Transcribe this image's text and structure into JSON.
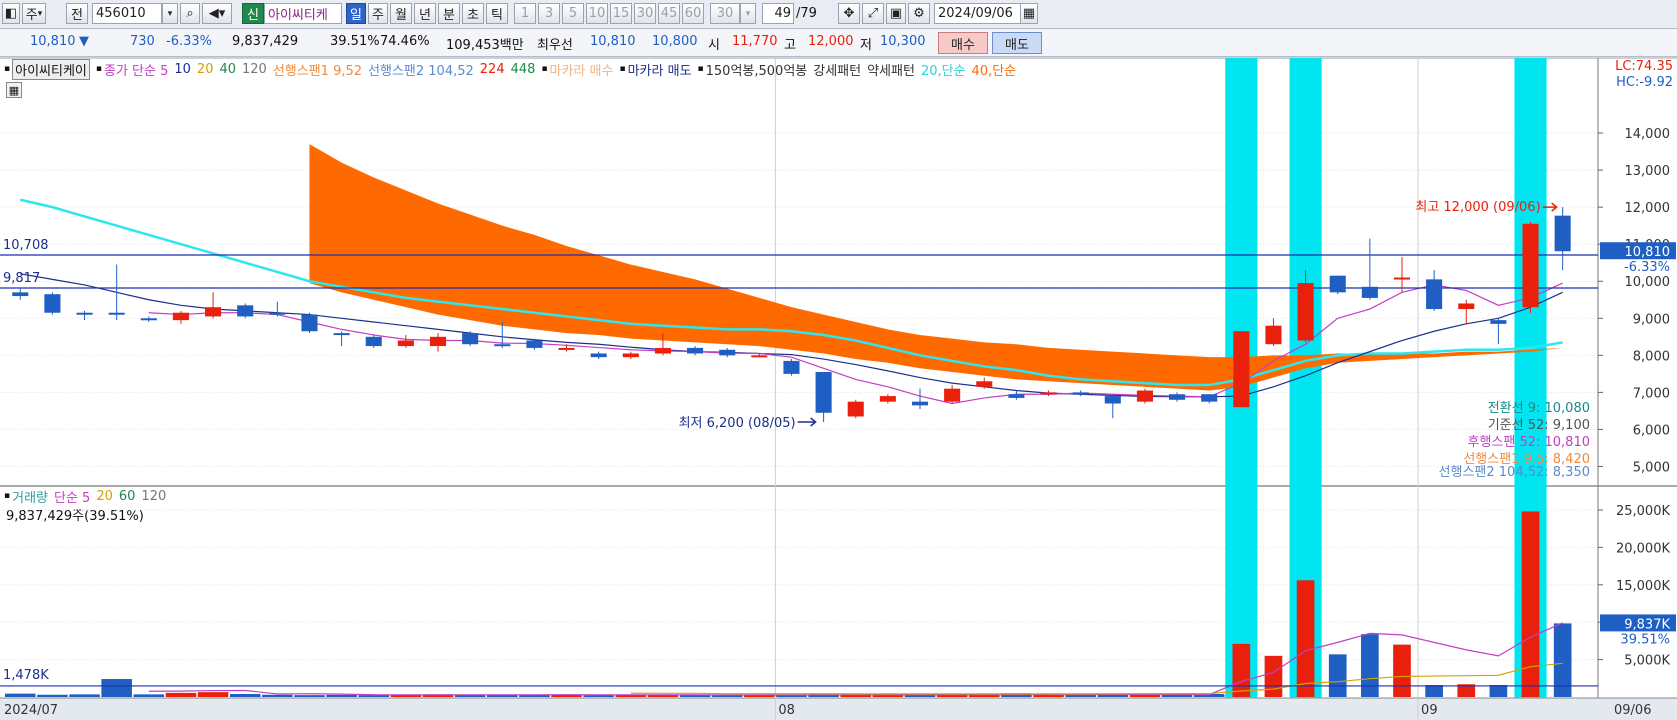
{
  "toolbar": {
    "market": "주",
    "prev": "전",
    "code": "456010",
    "badge": "신",
    "name": "아이씨티케",
    "periods": [
      "일",
      "주",
      "월",
      "년",
      "분",
      "초",
      "틱"
    ],
    "active_period": "일",
    "intervals": [
      "1",
      "3",
      "5",
      "10",
      "15",
      "30",
      "45",
      "60"
    ],
    "interval_value": "30",
    "page_counter": "49",
    "page_total": "/79",
    "date": "2024/09/06"
  },
  "info": {
    "price": "10,810",
    "change_arrow": "▼",
    "change": "730",
    "change_pct": "-6.33%",
    "volume": "9,837,429",
    "vol_pct": "39.51%",
    "pct2": "74.46%",
    "amount": "109,453백만",
    "best_label": "최우선",
    "best_sell": "10,810",
    "best_buy": "10,800",
    "open_label": "시",
    "open": "11,770",
    "high_label": "고",
    "high": "12,000",
    "low_label": "저",
    "low": "10,300",
    "buy_button": "매수",
    "sell_button": "매도"
  },
  "price_legend": {
    "name": "아이씨티케이",
    "close_ma": "종가 단순 5",
    "ma10": "10",
    "ma20": "20",
    "ma40": "40",
    "ma120": "120",
    "span1": "선행스팬1 9,52",
    "span2": "선행스팬2 104,52",
    "p224": "224",
    "p448": "448",
    "macara_buy": "마카라 매수",
    "macara_sell": "마카라 매도",
    "bong": "150억봉,500억봉",
    "strong": "강세패턴",
    "weak": "약세패턴",
    "ma20s": "20,단순",
    "ma40s": "40,단순"
  },
  "lc": "LC:74.35",
  "hc": "HC:-9.92",
  "price_axis": [
    "14,000",
    "13,000",
    "12,000",
    "11,000",
    "10,000",
    "9,000",
    "8,000",
    "7,000",
    "6,000",
    "5,000"
  ],
  "current_price_tag": "10,810",
  "current_pct_tag": "-6.33%",
  "line_10708": "10,708",
  "line_9817": "9,817",
  "high_annot": "최고 12,000 (09/06)",
  "low_annot": "최저 6,200 (08/05)",
  "ichimoku": {
    "conv": "전환선 9: 10,080",
    "base": "기준선 52: 9,100",
    "lag": "후행스팬 52: 10,810",
    "lead1": "선행스팬1 9,5: 8,420",
    "lead2": "선행스팬2 104,52: 8,350"
  },
  "vol_legend": {
    "name": "거래량",
    "ma": "단순 5",
    "v20": "20",
    "v60": "60",
    "v120": "120",
    "value": "9,837,429주(39.51%)"
  },
  "vol_axis": [
    "25,000K",
    "20,000K",
    "15,000K",
    "10,000K",
    "5,000K"
  ],
  "vol_current_tag": "9,837K",
  "vol_pct_tag": "39.51%",
  "vol_line_label": "1,478K",
  "date_axis": [
    "2024/07",
    "08",
    "09"
  ],
  "last_date": "09/06",
  "colors": {
    "up": "#e8200c",
    "down": "#1f5fc4",
    "cloud": "#ff6a00",
    "highlight": "#00e5f0",
    "ma_blue": "#1c2f8a",
    "ma_pink": "#c43ec4"
  },
  "chart_data": {
    "type": "candlestick",
    "candles": [
      {
        "o": 9700,
        "c": 9600,
        "h": 9800,
        "l": 9500
      },
      {
        "o": 9650,
        "c": 9150,
        "h": 9700,
        "l": 9100
      },
      {
        "o": 9150,
        "c": 9100,
        "h": 9200,
        "l": 8950
      },
      {
        "o": 9150,
        "c": 9100,
        "h": 10450,
        "l": 8950
      },
      {
        "o": 9000,
        "c": 8950,
        "h": 9050,
        "l": 8900
      },
      {
        "o": 8950,
        "c": 9150,
        "h": 9200,
        "l": 8850
      },
      {
        "o": 9050,
        "c": 9300,
        "h": 9700,
        "l": 9000
      },
      {
        "o": 9350,
        "c": 9050,
        "h": 9400,
        "l": 9000
      },
      {
        "o": 9150,
        "c": 9100,
        "h": 9450,
        "l": 9050
      },
      {
        "o": 9100,
        "c": 8650,
        "h": 9150,
        "l": 8600
      },
      {
        "o": 8600,
        "c": 8550,
        "h": 8650,
        "l": 8250
      },
      {
        "o": 8500,
        "c": 8250,
        "h": 8550,
        "l": 8200
      },
      {
        "o": 8250,
        "c": 8400,
        "h": 8550,
        "l": 8200
      },
      {
        "o": 8250,
        "c": 8500,
        "h": 8600,
        "l": 8100
      },
      {
        "o": 8600,
        "c": 8300,
        "h": 8650,
        "l": 8250
      },
      {
        "o": 8300,
        "c": 8250,
        "h": 8900,
        "l": 8200
      },
      {
        "o": 8400,
        "c": 8200,
        "h": 8450,
        "l": 8150
      },
      {
        "o": 8150,
        "c": 8200,
        "h": 8300,
        "l": 8100
      },
      {
        "o": 8050,
        "c": 7950,
        "h": 8100,
        "l": 7900
      },
      {
        "o": 7950,
        "c": 8050,
        "h": 8100,
        "l": 7900
      },
      {
        "o": 8050,
        "c": 8200,
        "h": 8600,
        "l": 8000
      },
      {
        "o": 8200,
        "c": 8050,
        "h": 8250,
        "l": 8000
      },
      {
        "o": 8150,
        "c": 8000,
        "h": 8200,
        "l": 7950
      },
      {
        "o": 8000,
        "c": 8000,
        "h": 8050,
        "l": 7950
      },
      {
        "o": 7850,
        "c": 7500,
        "h": 7900,
        "l": 7450
      },
      {
        "o": 7550,
        "c": 6450,
        "h": 7550,
        "l": 6200
      },
      {
        "o": 6350,
        "c": 6750,
        "h": 6800,
        "l": 6300
      },
      {
        "o": 6750,
        "c": 6900,
        "h": 6950,
        "l": 6700
      },
      {
        "o": 6750,
        "c": 6650,
        "h": 7100,
        "l": 6550
      },
      {
        "o": 6750,
        "c": 7100,
        "h": 7200,
        "l": 6700
      },
      {
        "o": 7150,
        "c": 7300,
        "h": 7400,
        "l": 7100
      },
      {
        "o": 6950,
        "c": 6850,
        "h": 7050,
        "l": 6800
      },
      {
        "o": 6950,
        "c": 7000,
        "h": 7050,
        "l": 6900
      },
      {
        "o": 7000,
        "c": 6950,
        "h": 7050,
        "l": 6900
      },
      {
        "o": 6900,
        "c": 6700,
        "h": 6950,
        "l": 6300
      },
      {
        "o": 6750,
        "c": 7050,
        "h": 7100,
        "l": 6700
      },
      {
        "o": 6950,
        "c": 6800,
        "h": 7000,
        "l": 6750
      },
      {
        "o": 6950,
        "c": 6750,
        "h": 6950,
        "l": 6700
      },
      {
        "o": 6600,
        "c": 8650,
        "h": 8650,
        "l": 6600
      },
      {
        "o": 8300,
        "c": 8800,
        "h": 9000,
        "l": 8250
      },
      {
        "o": 8400,
        "c": 9950,
        "h": 10300,
        "l": 8350
      },
      {
        "o": 10150,
        "c": 9700,
        "h": 10150,
        "l": 9650
      },
      {
        "o": 9850,
        "c": 9550,
        "h": 11150,
        "l": 9500
      },
      {
        "o": 10050,
        "c": 10100,
        "h": 10650,
        "l": 9700
      },
      {
        "o": 10050,
        "c": 9250,
        "h": 10300,
        "l": 9200
      },
      {
        "o": 9250,
        "c": 9400,
        "h": 9500,
        "l": 8850
      },
      {
        "o": 8950,
        "c": 8850,
        "h": 9000,
        "l": 8300
      },
      {
        "o": 9300,
        "c": 11550,
        "h": 11600,
        "l": 9150
      },
      {
        "o": 11770,
        "c": 10810,
        "h": 12000,
        "l": 10300
      }
    ],
    "volumes_k": [
      450,
      300,
      350,
      2400,
      350,
      550,
      650,
      400,
      300,
      250,
      280,
      250,
      280,
      350,
      280,
      330,
      300,
      300,
      230,
      300,
      300,
      250,
      260,
      300,
      250,
      380,
      300,
      220,
      250,
      350,
      280,
      500,
      300,
      280,
      300,
      300,
      300,
      400,
      7100,
      5500,
      15600,
      5700,
      8400,
      7000,
      1600,
      1700,
      1600,
      24800,
      9837
    ],
    "ma5_price": [
      null,
      null,
      null,
      null,
      9150,
      9100,
      9150,
      9150,
      9100,
      8900,
      8700,
      8550,
      8430,
      8400,
      8400,
      8330,
      8320,
      8270,
      8210,
      8150,
      8120,
      8100,
      8060,
      8050,
      7950,
      7650,
      7350,
      7150,
      6900,
      6700,
      6850,
      6950,
      6950,
      6980,
      6950,
      6920,
      6900,
      6880,
      7250,
      7850,
      8300,
      9000,
      9250,
      9700,
      9900,
      9750,
      9350,
      9550,
      9950
    ],
    "ma10_price": [
      10200,
      10050,
      9900,
      9700,
      9500,
      9350,
      9250,
      9200,
      9150,
      9100,
      9000,
      8900,
      8800,
      8700,
      8600,
      8500,
      8420,
      8350,
      8300,
      8220,
      8150,
      8100,
      8080,
      8050,
      8020,
      7900,
      7750,
      7580,
      7400,
      7250,
      7150,
      7050,
      6980,
      6950,
      6920,
      6890,
      6880,
      6880,
      6900,
      7150,
      7450,
      7800,
      8100,
      8400,
      8650,
      8850,
      9000,
      9300,
      9700
    ],
    "cloud_top": [
      null,
      null,
      null,
      null,
      null,
      null,
      null,
      null,
      null,
      13700,
      13200,
      12800,
      12450,
      12100,
      11800,
      11500,
      11250,
      10950,
      10700,
      10450,
      10250,
      10050,
      9800,
      9550,
      9300,
      9100,
      8900,
      8700,
      8550,
      8450,
      8350,
      8300,
      8200,
      8150,
      8100,
      8050,
      8000,
      7950,
      7950,
      8000,
      8000,
      8050,
      8050,
      8050,
      8050,
      8100,
      8100,
      8150,
      8200
    ],
    "cloud_bottom": [
      null,
      null,
      null,
      null,
      null,
      null,
      null,
      null,
      null,
      9950,
      9700,
      9500,
      9300,
      9100,
      8950,
      8800,
      8700,
      8600,
      8550,
      8450,
      8400,
      8350,
      8300,
      8250,
      8150,
      8050,
      7900,
      7800,
      7650,
      7550,
      7450,
      7350,
      7300,
      7250,
      7200,
      7150,
      7100,
      7050,
      7150,
      7400,
      7650,
      7800,
      7850,
      7900,
      7950,
      8000,
      8050,
      8100,
      8200
    ],
    "ma_cyan": [
      12200,
      12000,
      11750,
      11500,
      11250,
      11000,
      10750,
      10500,
      10250,
      10000,
      9850,
      9700,
      9550,
      9450,
      9350,
      9250,
      9150,
      9050,
      8950,
      8850,
      8800,
      8750,
      8700,
      8700,
      8650,
      8550,
      8400,
      8200,
      8000,
      7850,
      7700,
      7600,
      7450,
      7350,
      7300,
      7250,
      7200,
      7200,
      7350,
      7600,
      7850,
      8000,
      8050,
      8050,
      8100,
      8150,
      8150,
      8200,
      8350
    ],
    "ma_vol5_k": [
      null,
      null,
      null,
      null,
      770,
      790,
      860,
      870,
      410,
      430,
      380,
      300,
      280,
      290,
      290,
      290,
      290,
      310,
      280,
      290,
      290,
      280,
      270,
      280,
      270,
      290,
      300,
      280,
      280,
      300,
      280,
      330,
      320,
      320,
      340,
      330,
      330,
      320,
      2080,
      3280,
      6200,
      7300,
      8500,
      8300,
      7300,
      6300,
      5500,
      8000,
      9900
    ],
    "ma_vol20_k": [
      null,
      null,
      null,
      null,
      null,
      null,
      null,
      null,
      null,
      null,
      null,
      null,
      null,
      null,
      null,
      null,
      null,
      null,
      null,
      500,
      490,
      490,
      440,
      440,
      440,
      430,
      420,
      420,
      420,
      420,
      420,
      420,
      420,
      420,
      430,
      440,
      450,
      450,
      800,
      1050,
      1800,
      2050,
      2450,
      2750,
      2800,
      2850,
      2900,
      4050,
      4500
    ],
    "highlight_indices": [
      38,
      40,
      47
    ],
    "ylim": [
      4500,
      15000
    ],
    "vol_ylim": [
      0,
      27000
    ],
    "h_lines": [
      10708,
      9817
    ],
    "vol_h_line_k": 1478
  }
}
